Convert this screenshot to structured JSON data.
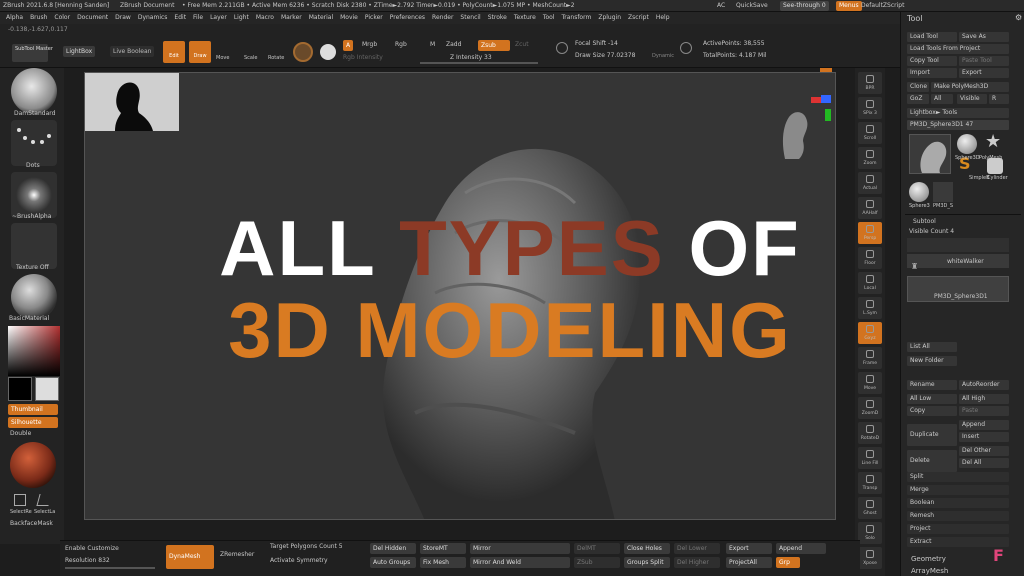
{
  "titlebar": {
    "app": "ZBrush 2021.6.8 [Henning Sanden]",
    "document": "ZBrush Document",
    "stats": "• Free Mem 2.211GB • Active Mem 6236 • Scratch Disk 2380 • ZTime►2.792 Timer►0.019 • PolyCount►1.075 MP • MeshCount►2",
    "ac": "AC",
    "quicksave": "QuickSave",
    "seethrough": "See-through  0",
    "menus": "Menus",
    "script": "DefaultZScript"
  },
  "menubar": [
    "Alpha",
    "Brush",
    "Color",
    "Document",
    "Draw",
    "Dynamics",
    "Edit",
    "File",
    "Layer",
    "Light",
    "Macro",
    "Marker",
    "Material",
    "Movie",
    "Picker",
    "Preferences",
    "Render",
    "Stencil",
    "Stroke",
    "Texture",
    "Tool",
    "Transform",
    "Zplugin",
    "Zscript",
    "Help"
  ],
  "coords": "-0.138,-1.627,0.117",
  "topbar": {
    "subtool_master": "SubTool Master",
    "lightbox": "LightBox",
    "live_boolean": "Live Boolean",
    "edit": "Edit",
    "draw": "Draw",
    "move": "Move",
    "scale": "Scale",
    "rotate": "Rotate",
    "a": "A",
    "mrgb": "Mrgb",
    "rgb": "Rgb",
    "m": "M",
    "zadd": "Zadd",
    "zsub": "Zsub",
    "zcut": "Zcut",
    "rgb_intensity": "Rgb Intensity",
    "z_intensity": "Z Intensity 33",
    "focal_shift": "Focal Shift -14",
    "draw_size": "Draw Size 77.02378",
    "dynamic": "Dynamic",
    "active_points": "ActivePoints: 38,555",
    "total_points": "TotalPoints: 4.187 Mil"
  },
  "leftshelf": {
    "brush": "DamStandard",
    "stroke": "Dots",
    "alpha": "~BrushAlpha",
    "texture": "Texture Off",
    "material": "BasicMaterial",
    "thumbnail": "Thumbnail",
    "silhouette": "Silhouette",
    "double": "Double",
    "selectrect": "SelectRe",
    "selectlasso": "SelectLa",
    "backface": "BackfaceMask"
  },
  "headline": {
    "line1_a": "ALL ",
    "line1_b": "TYPES",
    "line1_c": " OF",
    "line2": "3D MODELING"
  },
  "rightshelf": [
    "BPR",
    "SPix 3",
    "Scroll",
    "Zoom",
    "Actual",
    "AAHalf",
    "Persp",
    "Floor",
    "Local",
    "L.Sym",
    "Gxyz",
    "Frame",
    "Move",
    "ZoomD",
    "RotateD",
    "Line Fill",
    "Transp",
    "Ghost",
    "Solo",
    "Xpose"
  ],
  "tray": {
    "title": "Tool",
    "load_tool": "Load Tool",
    "save_as": "Save As",
    "load_from_project": "Load Tools From Project",
    "copy_tool": "Copy Tool",
    "paste_tool": "Paste Tool",
    "import": "Import",
    "export": "Export",
    "clone": "Clone",
    "make_polymesh": "Make PolyMesh3D",
    "goz": "GoZ",
    "all": "All",
    "visible": "Visible",
    "r": "R",
    "lightbox_tools": "Lightbox► Tools",
    "current_tool": "PM3D_Sphere3D1  47",
    "tool_labels": [
      "Sphere3D",
      "PolyMesh",
      "SimpleB",
      "Cylinder",
      "Sphere3",
      "PM3D_S"
    ],
    "subtool": "Subtool",
    "visible_count": "Visible Count 4",
    "subtool_1": "whiteWalker",
    "subtool_2": "PM3D_Sphere3D1",
    "list_all": "List All",
    "new_folder": "New Folder",
    "rename": "Rename",
    "autoreorder": "AutoReorder",
    "all_low": "All Low",
    "all_high": "All High",
    "copy": "Copy",
    "paste": "Paste",
    "duplicate": "Duplicate",
    "append": "Append",
    "insert": "Insert",
    "delete": "Delete",
    "del_other": "Del Other",
    "del_all": "Del All",
    "split": "Split",
    "merge": "Merge",
    "boolean": "Boolean",
    "remesh": "Remesh",
    "project": "Project",
    "extract": "Extract",
    "geometry": "Geometry",
    "arraymesh": "ArrayMesh"
  },
  "bottom": {
    "enable_customize": "Enable Customize",
    "resolution": "Resolution 832",
    "dynamesh": "DynaMesh",
    "zremesher": "ZRemesher",
    "target_polygons": "Target Polygons Count 5",
    "activate_symmetry": "Activate Symmetry",
    "del_hidden": "Del Hidden",
    "auto_groups": "Auto Groups",
    "storemt": "StoreMT",
    "fix_mesh": "Fix Mesh",
    "mirror": "Mirror",
    "mirror_weld": "Mirror And Weld",
    "divide": "DelMT",
    "zsub": "ZSub",
    "close_holes": "Close Holes",
    "groups_split": "Groups Split",
    "del_lower": "Del Lower",
    "del_higher": "Del Higher",
    "export": "Export",
    "projectall": "ProjectAll",
    "append": "Append",
    "grp": "Grp"
  },
  "colors": {
    "accent": "#d2731f",
    "headline_rust": "#8c3a26",
    "headline_white": "#ffffff",
    "headline_orange": "#d97b22"
  }
}
